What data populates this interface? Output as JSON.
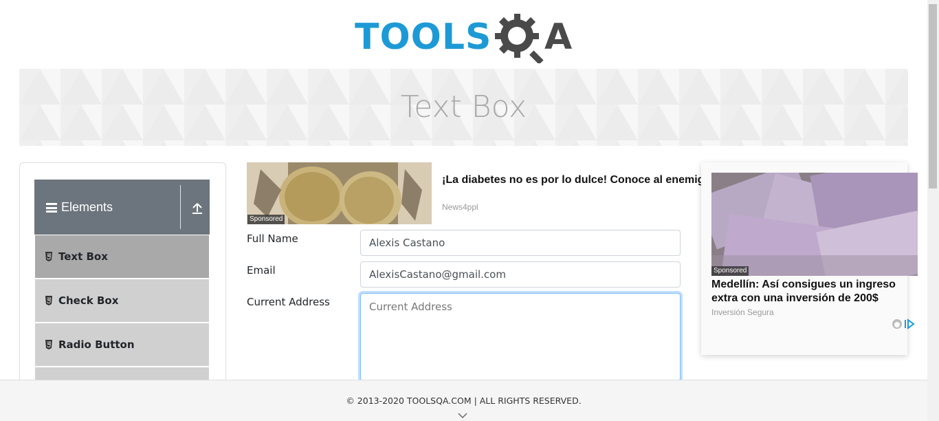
{
  "brand": {
    "logo_text": "TOOLS",
    "logo_accent": "A",
    "primary_color": "#1d9ad6",
    "dark_color": "#4a4a4a"
  },
  "page": {
    "title": "Text Box"
  },
  "sidebar": {
    "group_label": "Elements",
    "items": [
      {
        "label": "Text Box",
        "active": true
      },
      {
        "label": "Check Box",
        "active": false
      },
      {
        "label": "Radio Button",
        "active": false
      }
    ]
  },
  "ad_top": {
    "sponsored": "Sponsored",
    "title": "¡La diabetes no es por lo dulce! Conoce al enemigo real de la diabetes",
    "source": "News4ppl"
  },
  "form": {
    "full_name_label": "Full Name",
    "full_name_value": "Alexis Castano",
    "email_label": "Email",
    "email_value": "AlexisCastano@gmail.com",
    "address_label": "Current Address",
    "address_placeholder": "Current Address"
  },
  "ad_side": {
    "sponsored": "Sponsored",
    "title": "Medellín: Así consigues un ingreso extra con una inversión de 200$",
    "source": "Inversión Segura"
  },
  "footer": {
    "copyright": "© 2013-2020 TOOLSQA.COM | ALL RIGHTS RESERVED."
  }
}
